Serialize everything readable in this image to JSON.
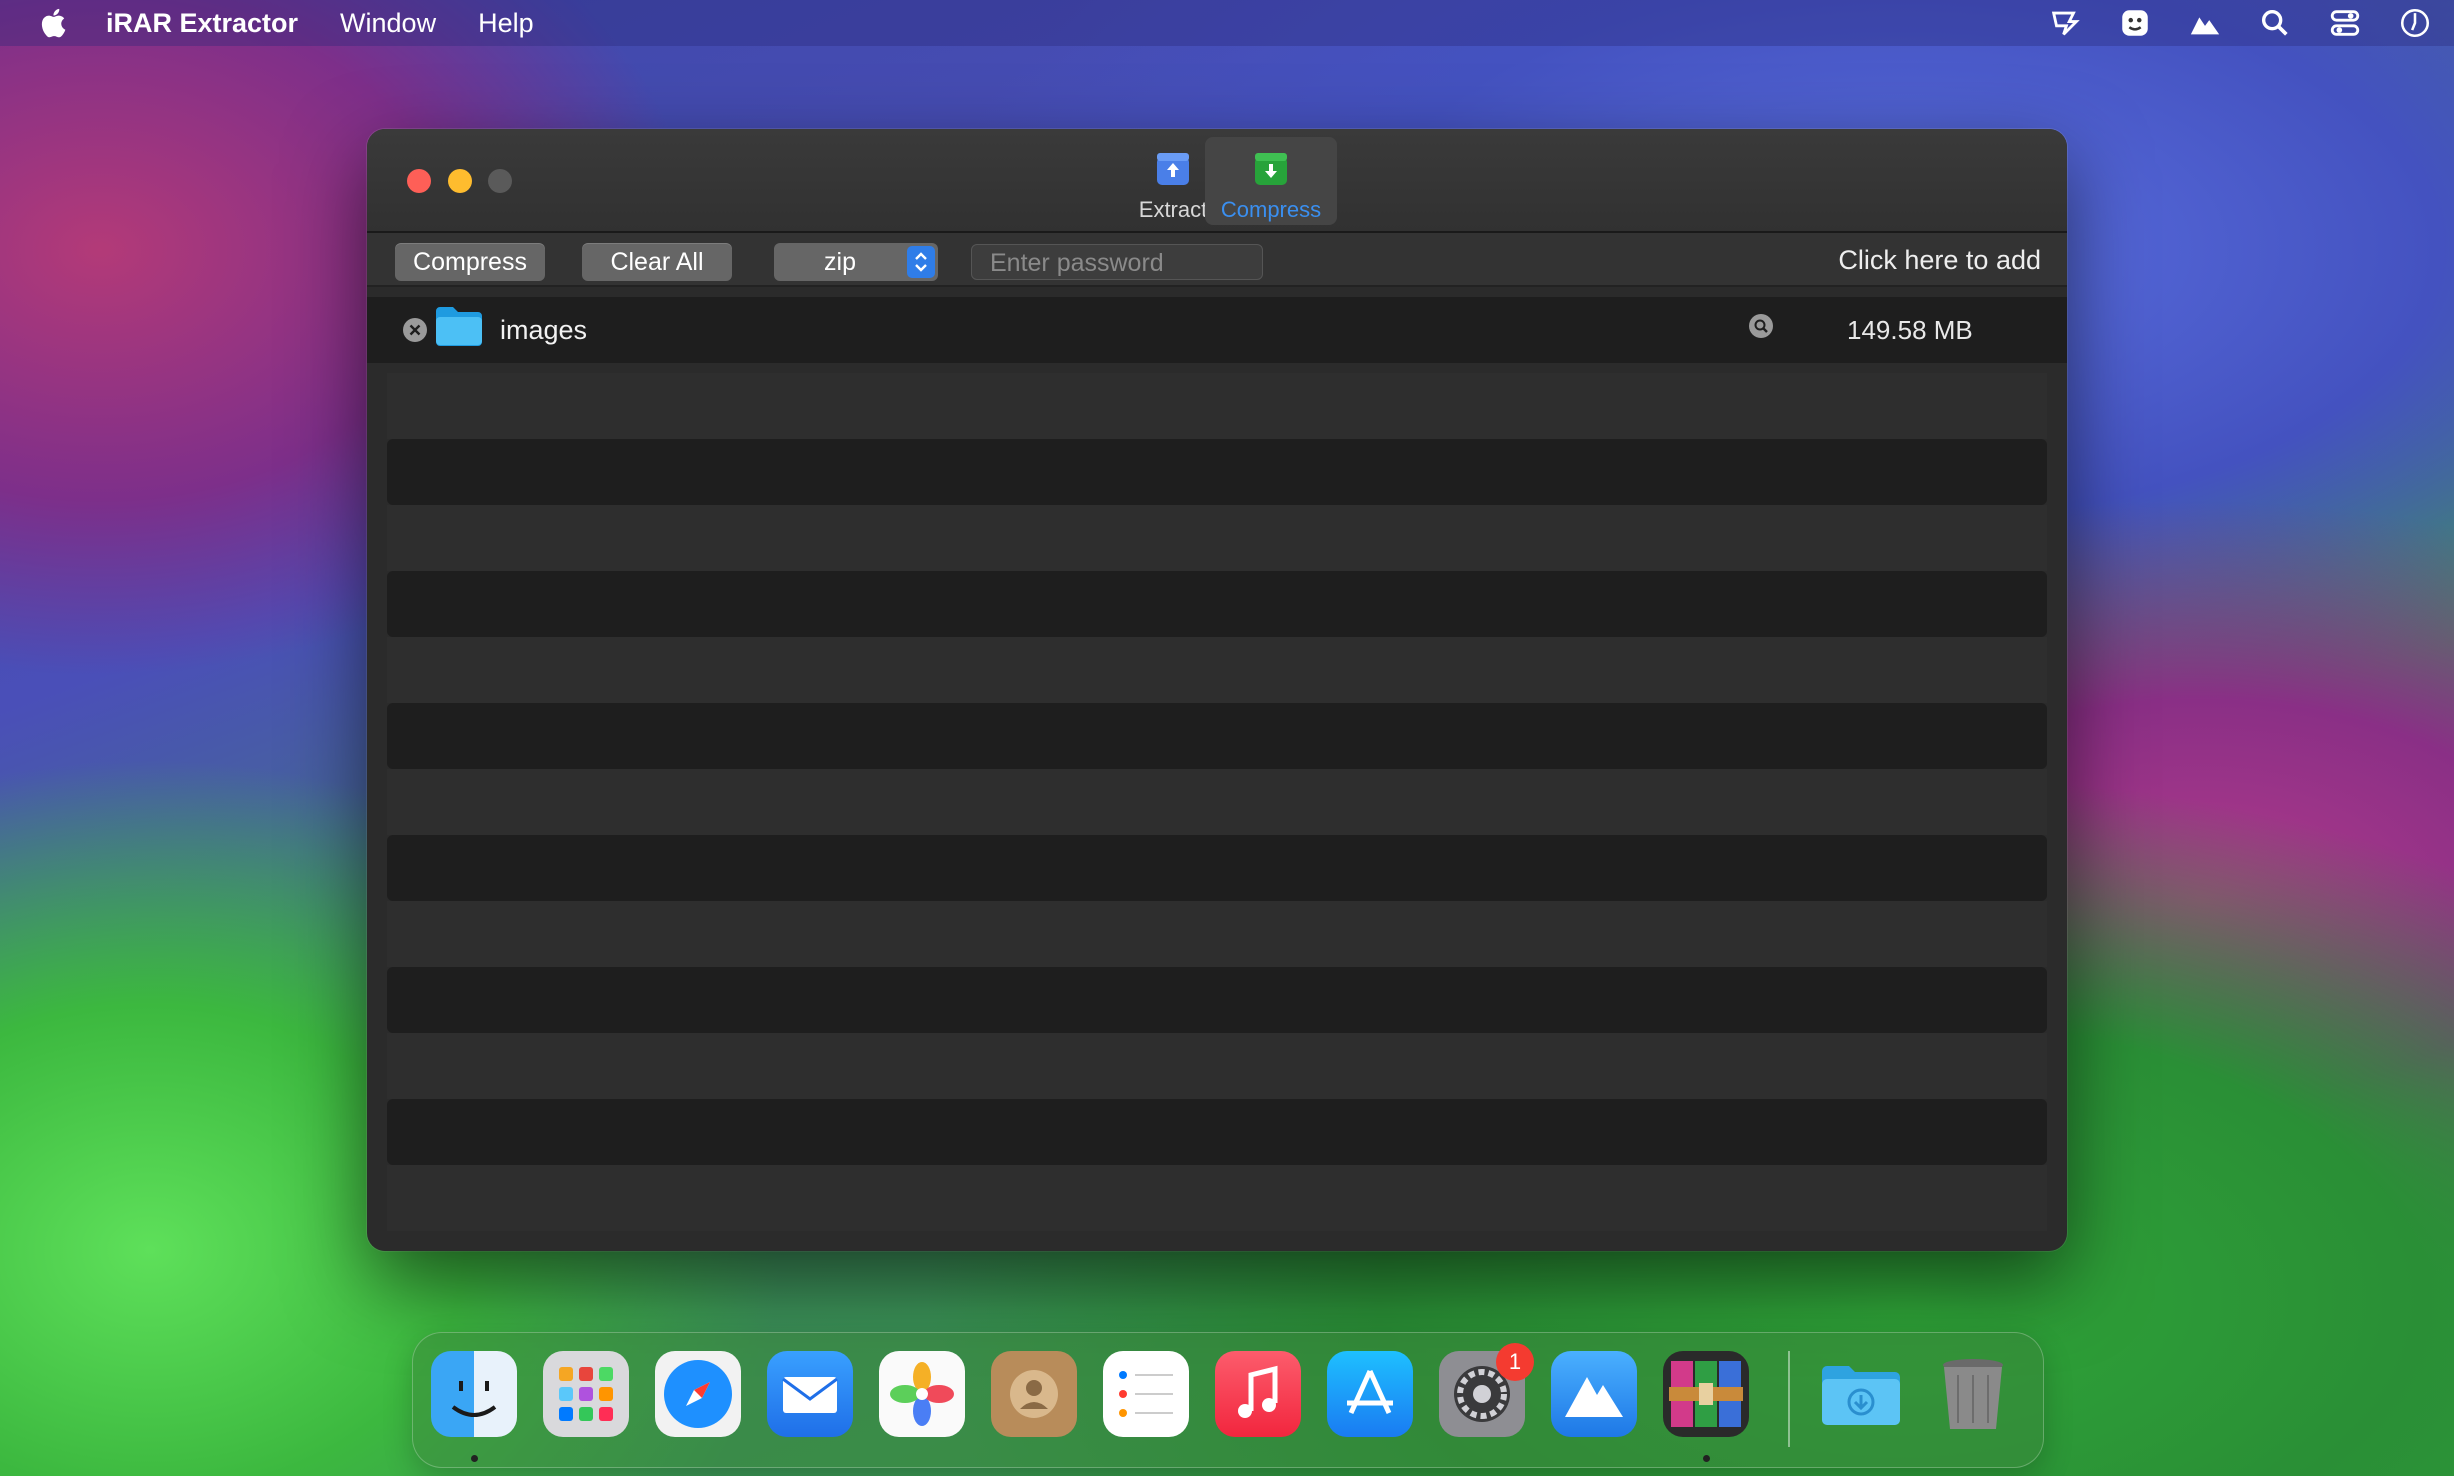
{
  "menubar": {
    "app_name": "iRAR Extractor",
    "items": [
      "Window",
      "Help"
    ],
    "status_icons": [
      "input-source-icon",
      "face-id-icon",
      "vpn-icon",
      "spotlight-search-icon",
      "control-center-icon",
      "clock-icon"
    ]
  },
  "window": {
    "tabs": [
      {
        "label": "Extract",
        "icon": "extract-icon"
      },
      {
        "label": "Compress",
        "icon": "compress-icon",
        "selected": true
      }
    ],
    "toolbar": {
      "compress_label": "Compress",
      "clear_label": "Clear All",
      "format_value": "zip",
      "password_placeholder": "Enter password",
      "add_hint": "Click here to add"
    },
    "files": [
      {
        "name": "images",
        "size": "149.58 MB",
        "icon": "folder-icon"
      }
    ]
  },
  "dock": {
    "apps": [
      "Finder",
      "Launchpad",
      "Safari",
      "Mail",
      "Photos",
      "Contacts",
      "Reminders",
      "Music",
      "App Store",
      "System Settings",
      "Migrate",
      "iRAR Extractor",
      "Downloads",
      "Trash"
    ],
    "settings_badge": "1"
  },
  "colors": {
    "accent_blue": "#3a8ff0",
    "close": "#fe5f57",
    "minimize": "#febc2e"
  }
}
